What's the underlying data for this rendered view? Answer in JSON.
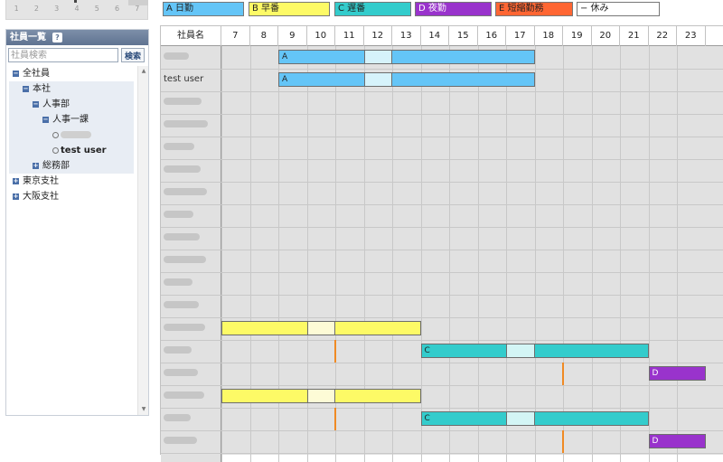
{
  "minical": {
    "days": [
      "1",
      "2",
      "3",
      "4",
      "5",
      "6",
      "7"
    ]
  },
  "employee_panel": {
    "title": "社員一覧",
    "help_label": "?",
    "search_placeholder": "社員検索",
    "search_button": "検索",
    "tree": [
      {
        "level": 0,
        "label": "全社員",
        "expander": "−"
      },
      {
        "level": 1,
        "label": "本社",
        "expander": "−"
      },
      {
        "level": 2,
        "label": "人事部",
        "expander": "−"
      },
      {
        "level": 3,
        "label": "人事一課",
        "expander": "−"
      },
      {
        "level": 4,
        "label": "",
        "blurred": true
      },
      {
        "level": 4,
        "label": "test user",
        "bold": true
      },
      {
        "level": 2,
        "label": "総務部",
        "expander": "+"
      },
      {
        "level": 0,
        "label": "東京支社",
        "expander": "+"
      },
      {
        "level": 0,
        "label": "大阪支社",
        "expander": "+"
      }
    ]
  },
  "legend": [
    {
      "label": "A 日勤",
      "color": "#64c5f7"
    },
    {
      "label": "B 早番",
      "color": "#fdfa66"
    },
    {
      "label": "C 遅番",
      "color": "#33cccc"
    },
    {
      "label": "D 夜勤",
      "color": "#9933cc"
    },
    {
      "label": "E 短縮勤務",
      "color": "#ff6633"
    },
    {
      "label": "− 休み",
      "color": "#ffffff"
    }
  ],
  "grid": {
    "name_header": "社員名",
    "hours": [
      "7",
      "8",
      "9",
      "10",
      "11",
      "12",
      "13",
      "14",
      "15",
      "16",
      "17",
      "18",
      "19",
      "20",
      "21",
      "22",
      "23"
    ],
    "employees": [
      {
        "name": "",
        "blurred": true
      },
      {
        "name": "test user",
        "blurred": false
      },
      {
        "name": "",
        "blurred": true
      },
      {
        "name": "",
        "blurred": true
      },
      {
        "name": "",
        "blurred": true
      },
      {
        "name": "",
        "blurred": true
      },
      {
        "name": "",
        "blurred": true
      },
      {
        "name": "",
        "blurred": true
      },
      {
        "name": "",
        "blurred": true
      },
      {
        "name": "",
        "blurred": true
      },
      {
        "name": "",
        "blurred": true
      },
      {
        "name": "",
        "blurred": true
      },
      {
        "name": "",
        "blurred": true
      },
      {
        "name": "",
        "blurred": true
      },
      {
        "name": "",
        "blurred": true
      },
      {
        "name": "",
        "blurred": true
      },
      {
        "name": "",
        "blurred": true
      },
      {
        "name": "",
        "blurred": true
      }
    ],
    "shifts": [
      {
        "row": 0,
        "code": "A",
        "start": 9,
        "end": 18,
        "break_start": 12,
        "break_end": 13,
        "color": "#64c5f7",
        "break_color": "#d6f3fb"
      },
      {
        "row": 1,
        "code": "A",
        "start": 9,
        "end": 18,
        "break_start": 12,
        "break_end": 13,
        "color": "#64c5f7",
        "break_color": "#d6f3fb"
      },
      {
        "row": 12,
        "code": "",
        "start": 7,
        "end": 14,
        "break_start": 10,
        "break_end": 11,
        "color": "#fdfa66",
        "break_color": "#fdfbd6"
      },
      {
        "row": 13,
        "code": "C",
        "start": 14,
        "end": 22,
        "break_start": 17,
        "break_end": 18,
        "color": "#33cccc",
        "break_color": "#d3f5f5"
      },
      {
        "row": 14,
        "code": "D",
        "start": 22,
        "end": 24,
        "color": "#9933cc"
      },
      {
        "row": 15,
        "code": "",
        "start": 7,
        "end": 14,
        "break_start": 10,
        "break_end": 11,
        "color": "#fdfa66",
        "break_color": "#fdfbd6"
      },
      {
        "row": 16,
        "code": "C",
        "start": 14,
        "end": 22,
        "break_start": 17,
        "break_end": 18,
        "color": "#33cccc",
        "break_color": "#d3f5f5"
      },
      {
        "row": 17,
        "code": "D",
        "start": 22,
        "end": 24,
        "color": "#9933cc"
      }
    ],
    "markers": [
      {
        "row": 13,
        "hour": 11
      },
      {
        "row": 14,
        "hour": 19
      },
      {
        "row": 16,
        "hour": 11
      },
      {
        "row": 17,
        "hour": 19
      }
    ]
  }
}
